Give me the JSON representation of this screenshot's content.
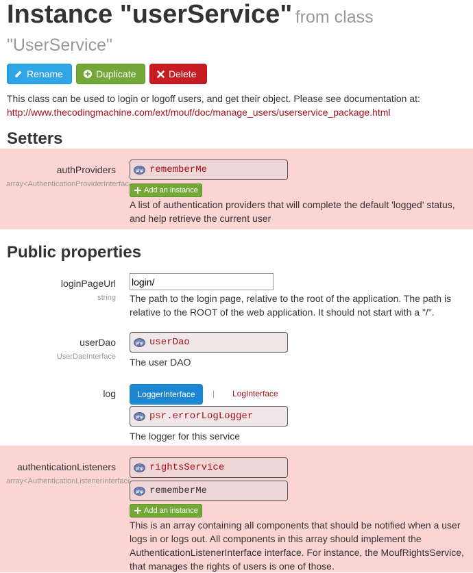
{
  "header": {
    "title_main": "Instance \"userService\"",
    "title_from": "from class",
    "class_name": "\"UserService\""
  },
  "buttons": {
    "rename": "Rename",
    "duplicate": "Duplicate",
    "delete": "Delete"
  },
  "description": {
    "text": "This class can be used to login or logoff users, and get their object. Please see documentation at:",
    "link": "http://www.thecodingmachine.com/ext/mouf/doc/manage_users/userservice_package.html"
  },
  "setters": {
    "heading": "Setters",
    "authProviders": {
      "label": "authProviders",
      "type": "array<AuthenticationProviderInterface>",
      "instances": [
        "rememberMe"
      ],
      "add_label": "Add an instance",
      "doc": "A list of authentication providers that will complete the default 'logged' status, and help retrieve the current user"
    }
  },
  "public_properties": {
    "heading": "Public properties",
    "loginPageUrl": {
      "label": "loginPageUrl",
      "type": "string",
      "value": "login/",
      "doc": "The path to the login page, relative to the root of the application. The path is relative to the ROOT of the web application. It should not start with a \"/\"."
    },
    "userDao": {
      "label": "userDao",
      "type": "UserDaoInterface",
      "instance": "userDao",
      "doc": "The user DAO"
    },
    "log": {
      "label": "log",
      "tab_active": "LoggerInterface",
      "separator": "|",
      "tab_inactive": "LogInterface",
      "instance": "psr.errorLogLogger",
      "doc": "The logger for this service"
    },
    "authenticationListeners": {
      "label": "authenticationListeners",
      "type": "array<AuthenticationListenerInterface>",
      "instances": [
        "rightsService",
        "rememberMe"
      ],
      "add_label": "Add an instance",
      "doc": "This is an array containing all components that should be notified when a user logs in or logs out. All components in this array should implement the AuthenticationListenerInterface interface. For instance, the MoufRightsService, that manages the rights of users is one of those."
    }
  }
}
